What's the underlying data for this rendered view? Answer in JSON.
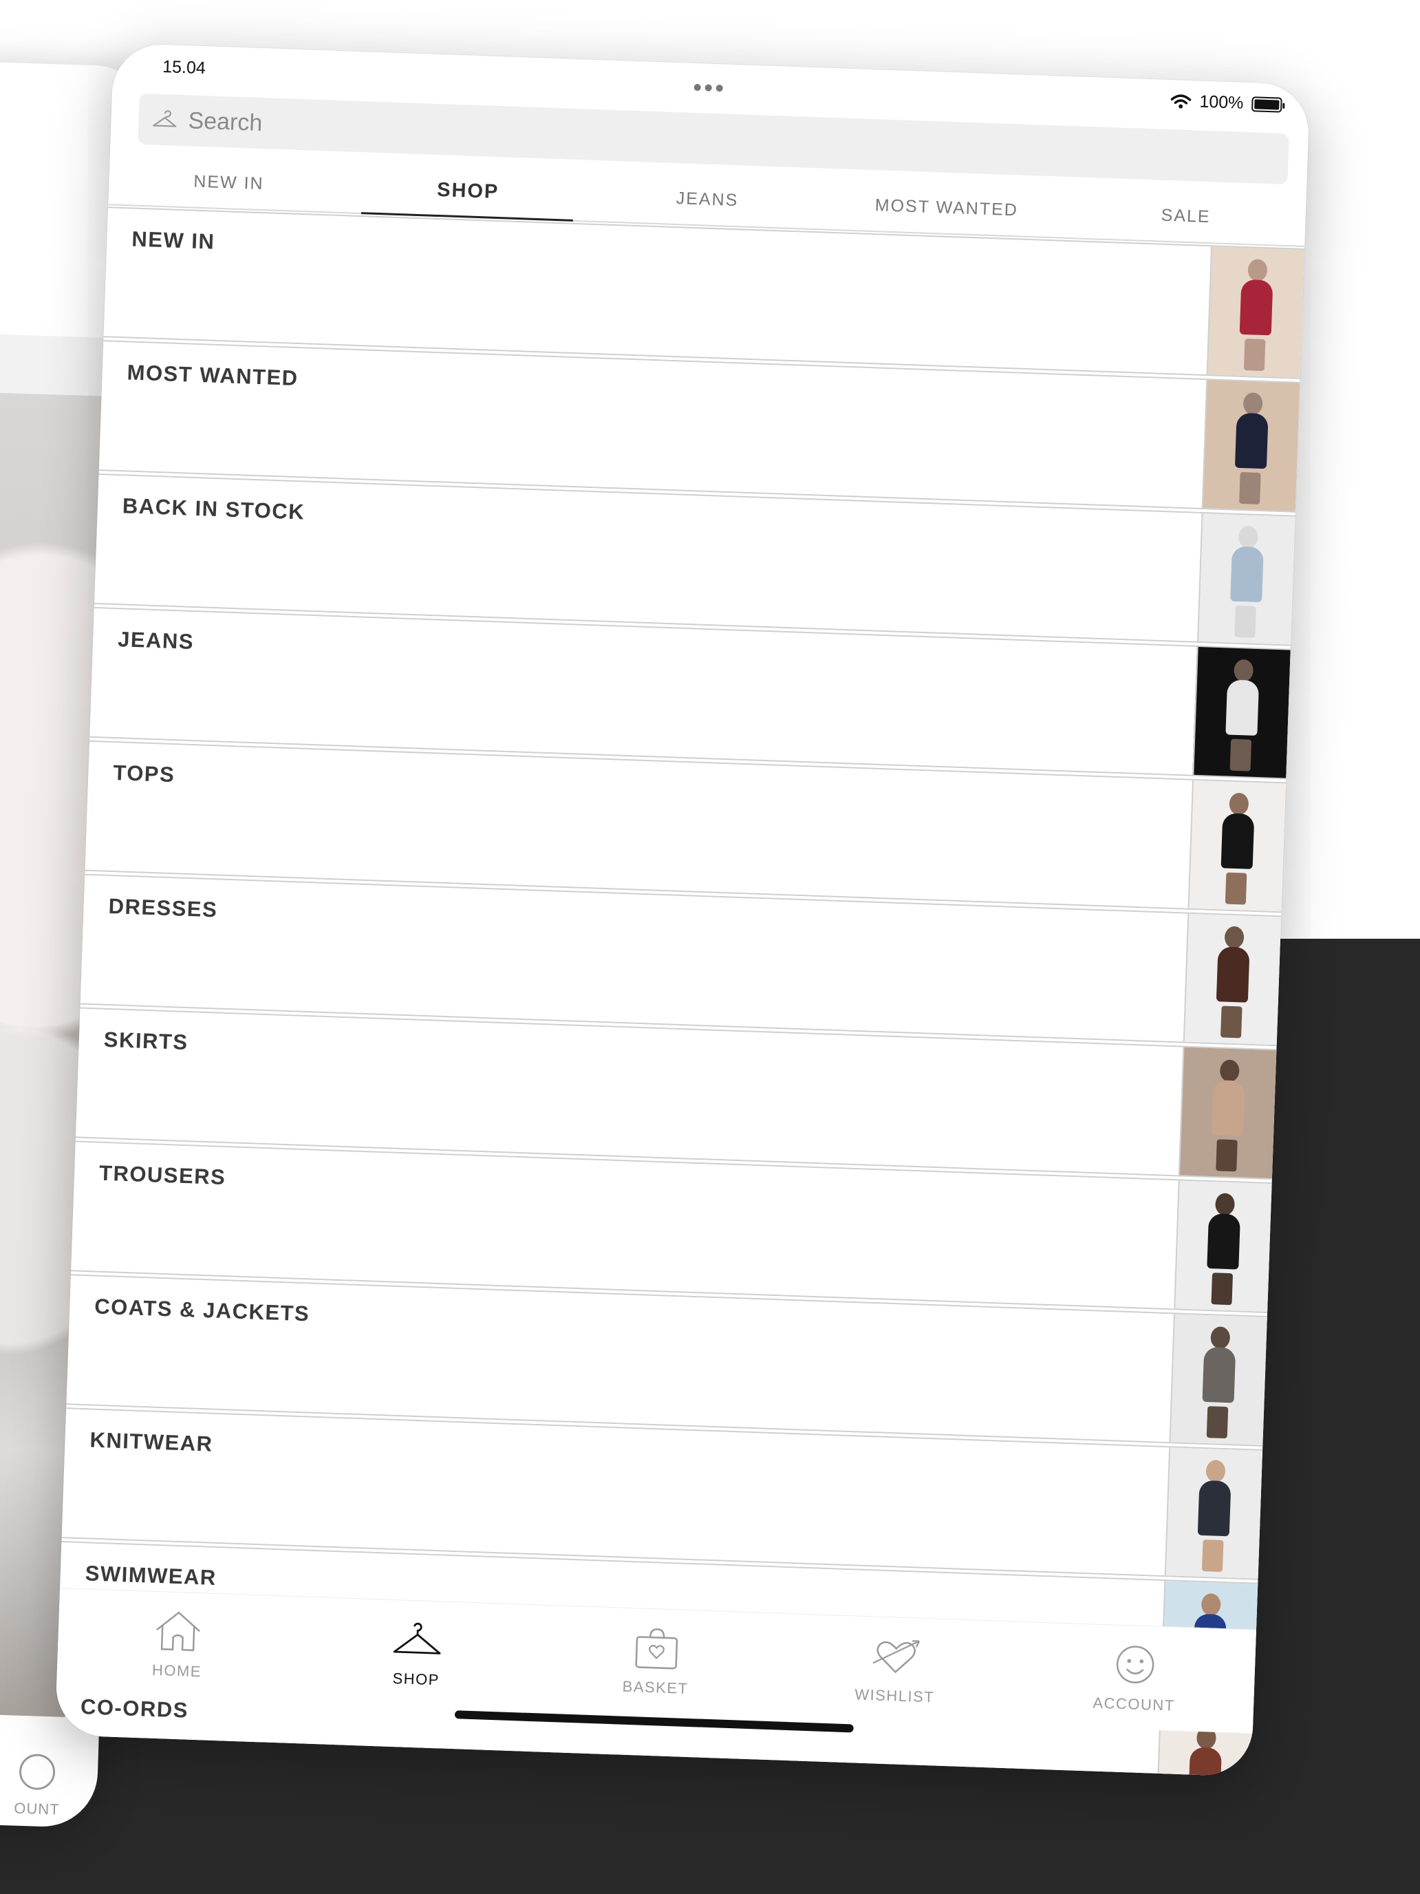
{
  "status_bar": {
    "time": "15.04",
    "battery": "100%"
  },
  "search": {
    "placeholder": "Search"
  },
  "top_tabs": [
    {
      "label": "NEW IN",
      "active": false
    },
    {
      "label": "SHOP",
      "active": true
    },
    {
      "label": "JEANS",
      "active": false
    },
    {
      "label": "MOST WANTED",
      "active": false
    },
    {
      "label": "SALE",
      "active": false
    }
  ],
  "categories": [
    {
      "label": "NEW IN",
      "thumb_colors": [
        "#b89a8a",
        "#a8243a",
        "#e7d7c8"
      ]
    },
    {
      "label": "MOST WANTED",
      "thumb_colors": [
        "#9c8478",
        "#1e2238",
        "#d7c0ac"
      ]
    },
    {
      "label": "BACK IN STOCK",
      "thumb_colors": [
        "#d9d9d9",
        "#a9bccf",
        "#ececec"
      ]
    },
    {
      "label": "JEANS",
      "thumb_colors": [
        "#6e5b4f",
        "#e6e6e6",
        "#111111"
      ]
    },
    {
      "label": "TOPS",
      "thumb_colors": [
        "#8e6f5c",
        "#141414",
        "#f0efee"
      ]
    },
    {
      "label": "DRESSES",
      "thumb_colors": [
        "#6e5748",
        "#4a2a22",
        "#eeeeee"
      ]
    },
    {
      "label": "SKIRTS",
      "thumb_colors": [
        "#5a4538",
        "#c6a58c",
        "#b8a393"
      ]
    },
    {
      "label": "TROUSERS",
      "thumb_colors": [
        "#4a3a30",
        "#161616",
        "#ededed"
      ]
    },
    {
      "label": "COATS & JACKETS",
      "thumb_colors": [
        "#5a4a40",
        "#6a6560",
        "#e9e9e9"
      ]
    },
    {
      "label": "KNITWEAR",
      "thumb_colors": [
        "#c9a58a",
        "#2a2f3a",
        "#ececec"
      ]
    },
    {
      "label": "SWIMWEAR",
      "thumb_colors": [
        "#b08a6f",
        "#233d8a",
        "#cfe2ec"
      ]
    },
    {
      "label": "CO-ORDS",
      "thumb_colors": [
        "#7a5a48",
        "#7a3b2c",
        "#efe9e4"
      ]
    }
  ],
  "tab_bar": [
    {
      "label": "HOME",
      "icon": "home-icon",
      "active": false
    },
    {
      "label": "SHOP",
      "icon": "hanger-icon",
      "active": true
    },
    {
      "label": "BASKET",
      "icon": "basket-icon",
      "active": false
    },
    {
      "label": "WISHLIST",
      "icon": "heart-arrow-icon",
      "active": false
    },
    {
      "label": "ACCOUNT",
      "icon": "smiley-icon",
      "active": false
    }
  ],
  "background_device": {
    "tab_label": "OUNT"
  }
}
